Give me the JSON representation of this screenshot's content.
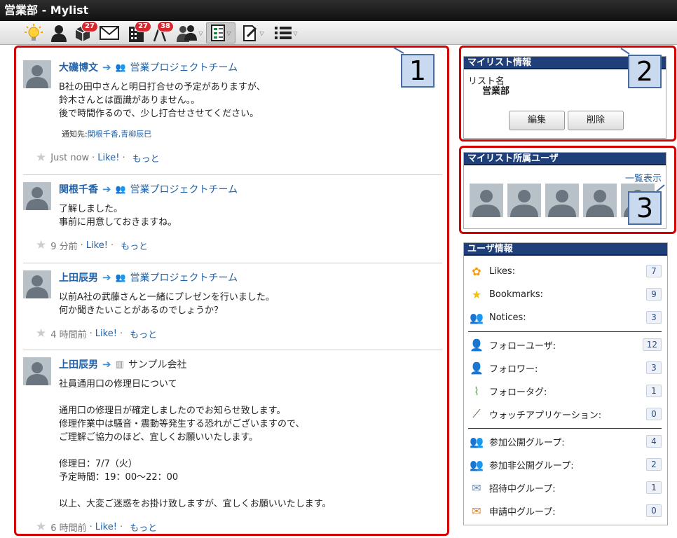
{
  "window": {
    "title": "営業部 - Mylist"
  },
  "toolbar": {
    "badges": {
      "apps": "27",
      "buildings": "27",
      "watch": "38"
    }
  },
  "posts": [
    {
      "author": "大磯博文",
      "group": "営業プロジェクトチーム",
      "lines": "B社の田中さんと明日打合せの予定がありますが、\n鈴木さんとは面識がありません。。\n後で時間作るので、少し打合せさせてください。",
      "notify_label": "通知先:",
      "notify_users": "関根千香,青柳辰巳",
      "time": "Just now",
      "like": "Like!",
      "more": "もっと"
    },
    {
      "author": "関根千香",
      "group": "営業プロジェクトチーム",
      "lines": "了解しました。\n事前に用意しておきますね。",
      "time": "9 分前",
      "like": "Like!",
      "more": "もっと"
    },
    {
      "author": "上田辰男",
      "group": "営業プロジェクトチーム",
      "lines": "以前A社の武藤さんと一緒にプレゼンを行いました。\n何か聞きたいことがあるのでしょうか？",
      "time": "4 時間前",
      "like": "Like!",
      "more": "もっと"
    },
    {
      "author": "上田辰男",
      "group": "サンプル会社",
      "lines": "社員通用口の修理日について\n\n通用口の修理日が確定しましたのでお知らせ致します。\n修理作業中は騒音・震動等発生する恐れがございますので、\nご理解ご協力のほど、宜しくお願いいたします。\n\n修理日：7/7（火）\n予定時間：19：00～22：00\n\n以上、大変ご迷惑をお掛け致しますが、宜しくお願いいたします。",
      "time": "6 時間前",
      "like": "Like!",
      "more": "もっと"
    }
  ],
  "separator": "·",
  "callouts": {
    "c1": "1",
    "c2": "2",
    "c3": "3"
  },
  "mylist": {
    "title": "マイリスト情報",
    "name_label": "リスト名",
    "name_value": "営業部",
    "edit": "編集",
    "delete": "削除"
  },
  "members": {
    "title": "マイリスト所属ユーザ",
    "list_link": "一覧表示"
  },
  "userinfo": {
    "title": "ユーザ情報",
    "rows": [
      {
        "label": "Likes:",
        "count": "7"
      },
      {
        "label": "Bookmarks:",
        "count": "9"
      },
      {
        "label": "Notices:",
        "count": "3"
      },
      {
        "label": "フォローユーザ:",
        "count": "12"
      },
      {
        "label": "フォロワー:",
        "count": "3"
      },
      {
        "label": "フォロータグ:",
        "count": "1"
      },
      {
        "label": "ウォッチアプリケーション:",
        "count": "0"
      },
      {
        "label": "参加公開グループ:",
        "count": "4"
      },
      {
        "label": "参加非公開グループ:",
        "count": "2"
      },
      {
        "label": "招待中グループ:",
        "count": "1"
      },
      {
        "label": "申請中グループ:",
        "count": "0"
      }
    ]
  }
}
